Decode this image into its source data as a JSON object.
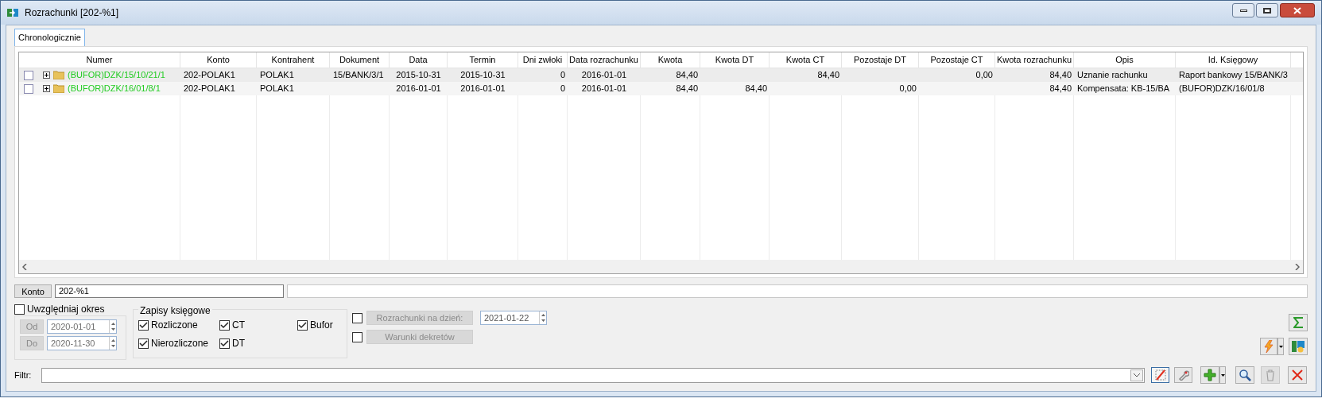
{
  "window": {
    "title": "Rozrachunki [202-%1]"
  },
  "tabs": [
    {
      "label": "Chronologicznie",
      "selected": true
    }
  ],
  "table": {
    "columns": [
      "Numer",
      "Konto",
      "Kontrahent",
      "Dokument",
      "Data",
      "Termin",
      "Dni zwłoki",
      "Data rozrachunku",
      "Kwota",
      "Kwota DT",
      "Kwota CT",
      "Pozostaje DT",
      "Pozostaje CT",
      "Kwota rozrachunku",
      "Opis",
      "Id. Księgowy"
    ],
    "rows": [
      {
        "checked": false,
        "expanded": false,
        "cells": [
          "(BUFOR)DZK/15/10/21/1",
          "202-POLAK1",
          "POLAK1",
          "15/BANK/3/1",
          "2015-10-31",
          "2015-10-31",
          "0",
          "2016-01-01",
          "84,40",
          "",
          "84,40",
          "",
          "0,00",
          "84,40",
          "Uznanie rachunku",
          "Raport bankowy 15/BANK/3"
        ]
      },
      {
        "checked": false,
        "expanded": false,
        "cells": [
          "(BUFOR)DZK/16/01/8/1",
          "202-POLAK1",
          "POLAK1",
          "",
          "2016-01-01",
          "2016-01-01",
          "0",
          "2016-01-01",
          "84,40",
          "84,40",
          "",
          "0,00",
          "",
          "84,40",
          "Kompensata: KB-15/BA",
          "(BUFOR)DZK/16/01/8"
        ]
      }
    ]
  },
  "konto": {
    "button": "Konto",
    "value": "202-%1"
  },
  "period": {
    "label": "Uwzględniaj okres",
    "checked": false,
    "from": {
      "button": "Od",
      "value": "2020-01-01",
      "disabled": true
    },
    "to": {
      "button": "Do",
      "value": "2020-11-30",
      "disabled": true
    }
  },
  "entries": {
    "title": "Zapisy księgowe",
    "options": [
      {
        "label": "Rozliczone",
        "checked": true
      },
      {
        "label": "CT",
        "checked": true
      },
      {
        "label": "Bufor",
        "checked": true
      },
      {
        "label": "Nierozliczone",
        "checked": true
      },
      {
        "label": "DT",
        "checked": true
      }
    ]
  },
  "settlements_on_day": {
    "checked": false,
    "button": "Rozrachunki na dzień:",
    "disabled": true,
    "value": "2021-01-22"
  },
  "posting_conditions": {
    "checked": false,
    "button": "Warunki dekretów",
    "disabled": true
  },
  "filter": {
    "label": "Filtr:"
  }
}
